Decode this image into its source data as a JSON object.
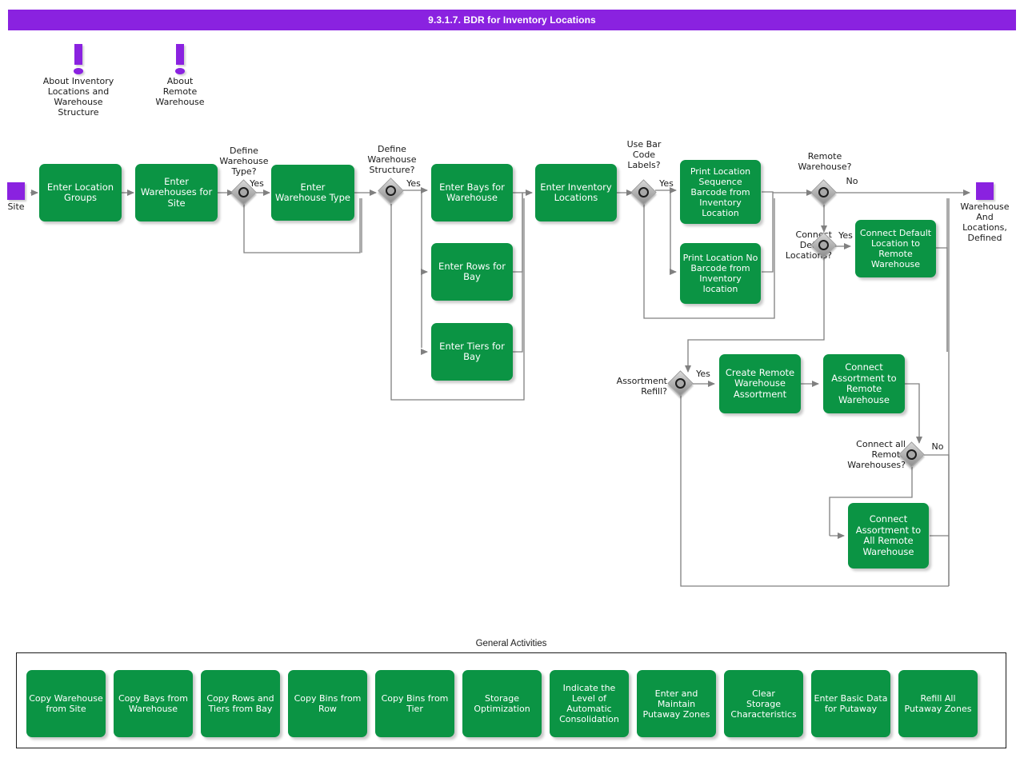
{
  "title": "9.3.1.7. BDR for Inventory Locations",
  "colors": {
    "header": "#8a22e0",
    "activity": "#0b9444",
    "event": "#8a22e0",
    "gateway": "#b3b3b3",
    "connector": "#808080",
    "text_light": "#ffffff",
    "text_dark": "#1a1a1a"
  },
  "notes": [
    {
      "icon": "exclamation-icon",
      "label": "About Inventory\nLocations and\nWarehouse\nStructure"
    },
    {
      "icon": "exclamation-icon",
      "label": "About\nRemote\nWarehouse"
    }
  ],
  "events": {
    "start": {
      "label": "Site"
    },
    "end": {
      "label": "Warehouse\nAnd\nLocations,\nDefined"
    }
  },
  "activities": [
    {
      "id": "enter-location-groups",
      "label": "Enter Location\nGroups"
    },
    {
      "id": "enter-warehouses-for-site",
      "label": "Enter\nWarehouses for\nSite"
    },
    {
      "id": "enter-warehouse-type",
      "label": "Enter\nWarehouse Type"
    },
    {
      "id": "enter-bays-for-warehouse",
      "label": "Enter Bays for\nWarehouse"
    },
    {
      "id": "enter-rows-for-bay",
      "label": "Enter Rows for\nBay"
    },
    {
      "id": "enter-tiers-for-bay",
      "label": "Enter Tiers for\nBay"
    },
    {
      "id": "enter-inventory-locations",
      "label": "Enter Inventory\nLocations"
    },
    {
      "id": "print-location-sequence-barcode",
      "label": "Print Location\nSequence\nBarcode from\nInventory\nLocation"
    },
    {
      "id": "print-location-no-barcode",
      "label": "Print Location No\nBarcode from\nInventory\nlocation"
    },
    {
      "id": "connect-default-location-to-remote-warehouse",
      "label": "Connect Default\nLocation to\nRemote\nWarehouse"
    },
    {
      "id": "create-remote-warehouse-assortment",
      "label": "Create Remote\nWarehouse\nAssortment"
    },
    {
      "id": "connect-assortment-to-remote-warehouse",
      "label": "Connect\nAssortment to\nRemote\nWarehouse"
    },
    {
      "id": "connect-assortment-to-all-remote-warehouse",
      "label": "Connect\nAssortment to\nAll Remote\nWarehouse"
    }
  ],
  "gateways": [
    {
      "id": "define-warehouse-type",
      "label": "Define\nWarehouse\nType?",
      "branch": "Yes"
    },
    {
      "id": "define-warehouse-structure",
      "label": "Define\nWarehouse\nStructure?",
      "branch": "Yes"
    },
    {
      "id": "use-bar-code-labels",
      "label": "Use Bar\nCode\nLabels?",
      "branch": "Yes"
    },
    {
      "id": "remote-warehouse",
      "label": "Remote\nWarehouse?",
      "branch": "No"
    },
    {
      "id": "connect-default-locations",
      "label": "Connect\nDefault\nLocations?",
      "branch": "Yes"
    },
    {
      "id": "assortment-refill",
      "label": "Assortment\nRefill?",
      "branch": "Yes"
    },
    {
      "id": "connect-all-remote-warehouses",
      "label": "Connect all\nRemote\nWarehouses?",
      "branch": "No"
    }
  ],
  "general_activities": {
    "title": "General Activities",
    "items": [
      {
        "label": "Copy Warehouse\nfrom Site"
      },
      {
        "label": "Copy Bays from\nWarehouse"
      },
      {
        "label": "Copy Rows and\nTiers from Bay"
      },
      {
        "label": "Copy Bins from\nRow"
      },
      {
        "label": "Copy Bins from\nTier"
      },
      {
        "label": "Storage\nOptimization"
      },
      {
        "label": "Indicate the\nLevel of\nAutomatic\nConsolidation"
      },
      {
        "label": "Enter and\nMaintain\nPutaway Zones"
      },
      {
        "label": "Clear\nStorage\nCharacteristics"
      },
      {
        "label": "Enter Basic Data\nfor Putaway"
      },
      {
        "label": "Refill All\nPutaway Zones"
      }
    ]
  }
}
